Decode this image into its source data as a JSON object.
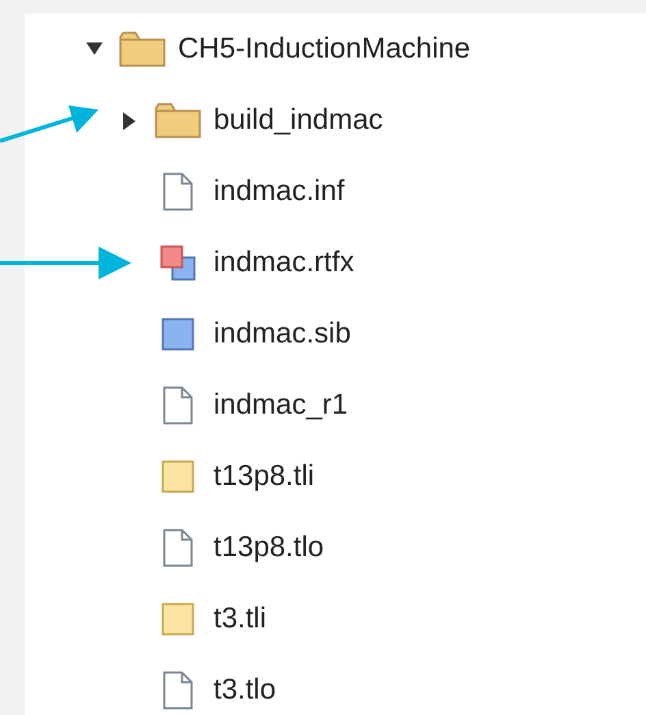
{
  "tree": [
    {
      "label": "CH5-InductionMachine",
      "kind": "folder",
      "expanded": true,
      "children": [
        {
          "label": "build_indmac",
          "kind": "folder",
          "expanded": false
        },
        {
          "label": "indmac.inf",
          "kind": "file"
        },
        {
          "label": "indmac.rtfx",
          "kind": "model"
        },
        {
          "label": "indmac.sib",
          "kind": "library"
        },
        {
          "label": "indmac_r1",
          "kind": "file"
        },
        {
          "label": "t13p8.tli",
          "kind": "input"
        },
        {
          "label": "t13p8.tlo",
          "kind": "file"
        },
        {
          "label": "t3.tli",
          "kind": "input"
        },
        {
          "label": "t3.tlo",
          "kind": "file"
        }
      ]
    }
  ]
}
